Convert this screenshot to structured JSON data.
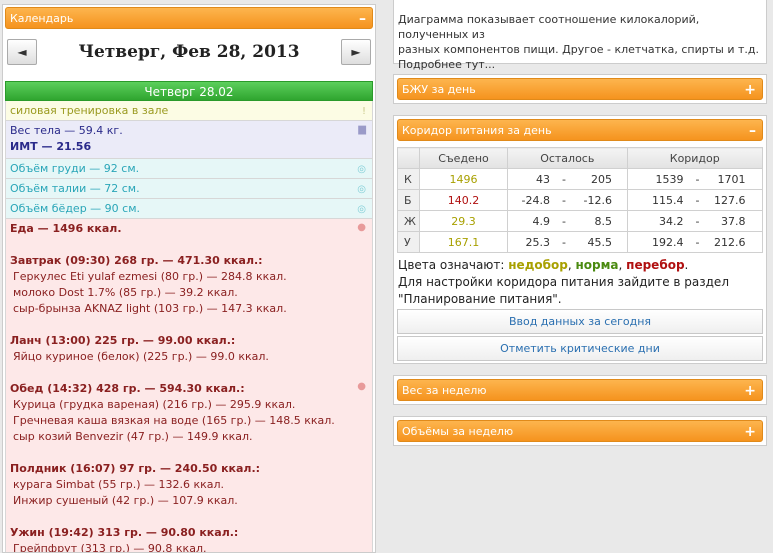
{
  "calendar": {
    "header_title": "Календарь",
    "header_ctrl": "–",
    "prev_label": "◄",
    "next_label": "►",
    "date_title": "Четверг, Фев 28, 2013",
    "day_head": "Четверг 28.02"
  },
  "day": {
    "training": "силовая тренировка в зале",
    "weight": "Вес тела — 59.4 кг.",
    "bmi": "ИМТ — 21.56",
    "chest": "Объём груди — 92 см.",
    "waist": "Объём талии — 72 см.",
    "hips": "Объём бёдер — 90 см.",
    "food_total": "Еда — 1496 ккал.",
    "meals": [
      {
        "head": "Завтрак (09:30) 268 гр. — 471.30 ккал.:",
        "items": [
          "Геркулес Eti yulaf ezmesi (80 гр.) — 284.8 ккал.",
          "молоко Dost 1.7% (85 гр.) — 39.2 ккал.",
          "сыр-брынза AKNAZ light (103 гр.) — 147.3 ккал."
        ]
      },
      {
        "head": "Ланч (13:00) 225 гр. — 99.00 ккал.:",
        "items": [
          "Яйцо куриное (белок) (225 гр.) — 99.0 ккал."
        ]
      },
      {
        "head": "Обед (14:32) 428 гр. — 594.30 ккал.:",
        "items": [
          "Курица (грудка вареная) (216 гр.) — 295.9 ккал.",
          "Гречневая каша вязкая на воде (165 гр.) — 148.5 ккал.",
          "сыр козий Benvezir (47 гр.) — 149.9 ккал."
        ]
      },
      {
        "head": "Полдник (16:07) 97 гр. — 240.50 ккал.:",
        "items": [
          "курага Simbat (55 гр.) — 132.6 ккал.",
          "Инжир сушеный (42 гр.) — 107.9 ккал."
        ]
      },
      {
        "head": "Ужин (19:42) 313 гр. — 90.80 ккал.:",
        "items": [
          "Грейпфрут (313 гр.) — 90.8 ккал."
        ]
      }
    ]
  },
  "description": {
    "line1": "Диаграмма показывает соотношение килокалорий, полученных из",
    "line2": "разных компонентов пищи. Другое - клетчатка, спирты и т.д.",
    "more_link": "Подробнее тут..."
  },
  "bju": {
    "title": "БЖУ за день",
    "ctrl": "+"
  },
  "corridor": {
    "title": "Коридор питания за день",
    "ctrl": "–",
    "col_eaten": "Съедено",
    "col_left": "Осталось",
    "col_corridor": "Коридор",
    "rows": [
      {
        "label": "К",
        "eaten": "1496",
        "left_a": "43",
        "left_b": "205",
        "corr_a": "1539",
        "corr_b": "1701",
        "color": "#a8a000"
      },
      {
        "label": "Б",
        "eaten": "140.2",
        "left_a": "-24.8",
        "left_b": "-12.6",
        "corr_a": "115.4",
        "corr_b": "127.6",
        "color": "#b01010"
      },
      {
        "label": "Ж",
        "eaten": "29.3",
        "left_a": "4.9",
        "left_b": "8.5",
        "corr_a": "34.2",
        "corr_b": "37.8",
        "color": "#a8a000"
      },
      {
        "label": "У",
        "eaten": "167.1",
        "left_a": "25.3",
        "left_b": "45.5",
        "corr_a": "192.4",
        "corr_b": "212.6",
        "color": "#a8a000"
      }
    ],
    "legend_prefix": "Цвета означают:",
    "legend_under": "недобор",
    "legend_norm": "норма",
    "legend_over": "перебор",
    "legend_end": ".",
    "hint": "Для настройки коридора питания зайдите в раздел \"Планирование питания\".",
    "btn_enter": "Ввод данных за сегодня",
    "btn_critical": "Отметить критические дни"
  },
  "weight_week": {
    "title": "Вес за неделю",
    "ctrl": "+"
  },
  "volumes_week": {
    "title": "Объёмы за неделю",
    "ctrl": "+"
  }
}
